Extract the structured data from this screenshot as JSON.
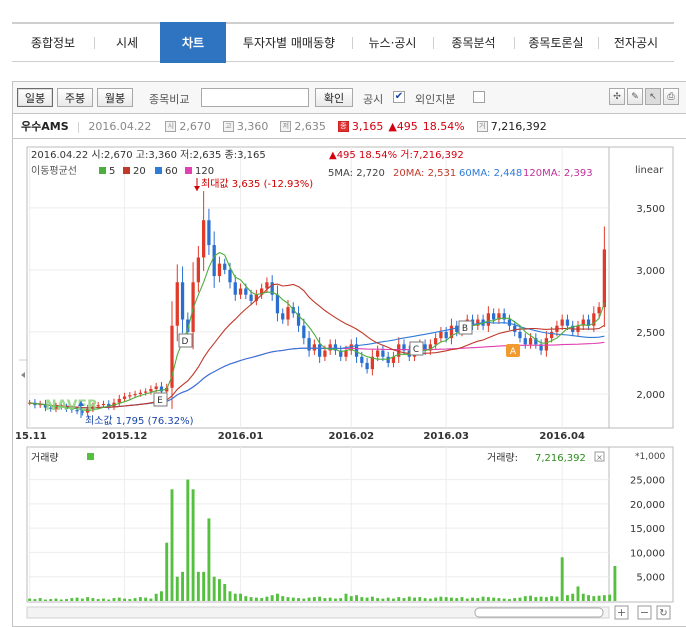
{
  "nav": {
    "tabs": [
      {
        "label": "종합정보"
      },
      {
        "label": "시세"
      },
      {
        "label": "차트"
      },
      {
        "label": "투자자별 매매동향"
      },
      {
        "label": "뉴스·공시"
      },
      {
        "label": "종목분석"
      },
      {
        "label": "종목토론실"
      },
      {
        "label": "전자공시"
      }
    ]
  },
  "toolbar": {
    "daily": "일봉",
    "weekly": "주봉",
    "monthly": "월봉",
    "compare_label": "종목비교",
    "compare_value": "",
    "confirm": "확인",
    "disclosure_label": "공시",
    "disclosure_check": "✔",
    "foreign_label": "외인지분"
  },
  "info": {
    "stock_name": "우수AMS",
    "date": "2016.04.22",
    "open_badge": "시",
    "open": "2,670",
    "high_badge": "고",
    "high": "3,360",
    "low_badge": "저",
    "low": "2,635",
    "close_badge": "종",
    "close": "3,165",
    "change": "▲495",
    "change_pct": "18.54%",
    "volume_badge": "거",
    "volume": "7,216,392"
  },
  "chart": {
    "header_line": "2016.04.22 시:2,670 고:3,360 저:2,635 종:3,165",
    "header_change": "▲495 18.54% 거:7,216,392",
    "ma_title": "이동평균선",
    "ma_periods": [
      "5",
      "20",
      "60",
      "120"
    ],
    "ma_values": [
      "5MA: 2,720",
      "20MA: 2,531",
      "60MA: 2,448",
      "120MA: 2,393"
    ],
    "scale_label": "linear",
    "max_label": "최대값 3,635 (-12.93%)",
    "min_label": "최소값 1,795 (76.32%)",
    "watermark": "NAVER",
    "markers": [
      "A",
      "B",
      "C",
      "D",
      "E"
    ],
    "volume_label": "거래량",
    "volume_readout_label": "거래량:",
    "volume_readout": "7,216,392",
    "multiplier": "*1,000",
    "colors": {
      "up": "#e03a2a",
      "down": "#2a6fd0",
      "ma5": "#4cae3c",
      "ma20": "#c0392b",
      "ma60": "#2f7bd8",
      "ma120": "#e040b0",
      "vol": "#55c040"
    }
  },
  "chart_data": {
    "type": "bar",
    "title": "",
    "price_axis": {
      "ticks": [
        2000,
        2500,
        3000,
        3500
      ],
      "tick_labels": [
        "2,000",
        "2,500",
        "3,000",
        "3,500"
      ],
      "ylim": [
        1750,
        3700
      ],
      "scale": "linear"
    },
    "volume_axis": {
      "ticks": [
        5000,
        10000,
        15000,
        20000,
        25000
      ],
      "tick_labels": [
        "5,000",
        "10,000",
        "15,000",
        "20,000",
        "25,000"
      ],
      "ylim": [
        0,
        28000
      ],
      "unit": "thousand shares"
    },
    "x_ticks": [
      {
        "label": "15.11",
        "index": 0
      },
      {
        "label": "2015.12",
        "index": 18
      },
      {
        "label": "2016.01",
        "index": 40
      },
      {
        "label": "2016.02",
        "index": 61
      },
      {
        "label": "2016.03",
        "index": 79
      },
      {
        "label": "2016.04",
        "index": 101
      }
    ],
    "close": [
      1930,
      1910,
      1920,
      1890,
      1880,
      1900,
      1895,
      1880,
      1870,
      1860,
      1850,
      1880,
      1900,
      1910,
      1920,
      1900,
      1930,
      1960,
      1980,
      1990,
      2000,
      2010,
      2020,
      2040,
      2060,
      2020,
      2050,
      2550,
      2900,
      2600,
      2500,
      2900,
      3100,
      3400,
      3200,
      2950,
      3050,
      3000,
      2900,
      2800,
      2850,
      2800,
      2750,
      2800,
      2850,
      2900,
      2800,
      2650,
      2600,
      2700,
      2650,
      2550,
      2450,
      2350,
      2400,
      2300,
      2350,
      2400,
      2350,
      2300,
      2350,
      2400,
      2300,
      2250,
      2200,
      2300,
      2350,
      2300,
      2250,
      2300,
      2400,
      2350,
      2300,
      2350,
      2400,
      2350,
      2400,
      2450,
      2500,
      2450,
      2550,
      2500,
      2550,
      2600,
      2550,
      2600,
      2550,
      2650,
      2600,
      2650,
      2600,
      2550,
      2500,
      2450,
      2400,
      2450,
      2400,
      2350,
      2450,
      2500,
      2550,
      2600,
      2550,
      2500,
      2550,
      2600,
      2550,
      2650,
      2700,
      3165
    ],
    "volume": [
      500,
      400,
      600,
      300,
      400,
      500,
      300,
      400,
      600,
      700,
      500,
      800,
      600,
      400,
      500,
      300,
      600,
      700,
      500,
      400,
      600,
      800,
      700,
      500,
      1500,
      2000,
      12000,
      23000,
      5000,
      6000,
      25000,
      23000,
      6000,
      6000,
      17000,
      5000,
      4500,
      3500,
      2000,
      1500,
      1500,
      1000,
      800,
      700,
      600,
      900,
      1200,
      1500,
      1000,
      800,
      700,
      600,
      500,
      700,
      800,
      900,
      600,
      700,
      500,
      600,
      1500,
      1000,
      1200,
      800,
      700,
      900,
      600,
      500,
      700,
      500,
      800,
      600,
      900,
      700,
      800,
      600,
      500,
      700,
      900,
      800,
      700,
      600,
      800,
      500,
      700,
      600,
      900,
      800,
      700,
      600,
      500,
      400,
      600,
      700,
      1000,
      1100,
      800,
      900,
      800,
      1000,
      900,
      9000,
      1200,
      1500,
      3000,
      1500,
      1200,
      1000,
      1100,
      1200,
      1300,
      7216
    ]
  }
}
